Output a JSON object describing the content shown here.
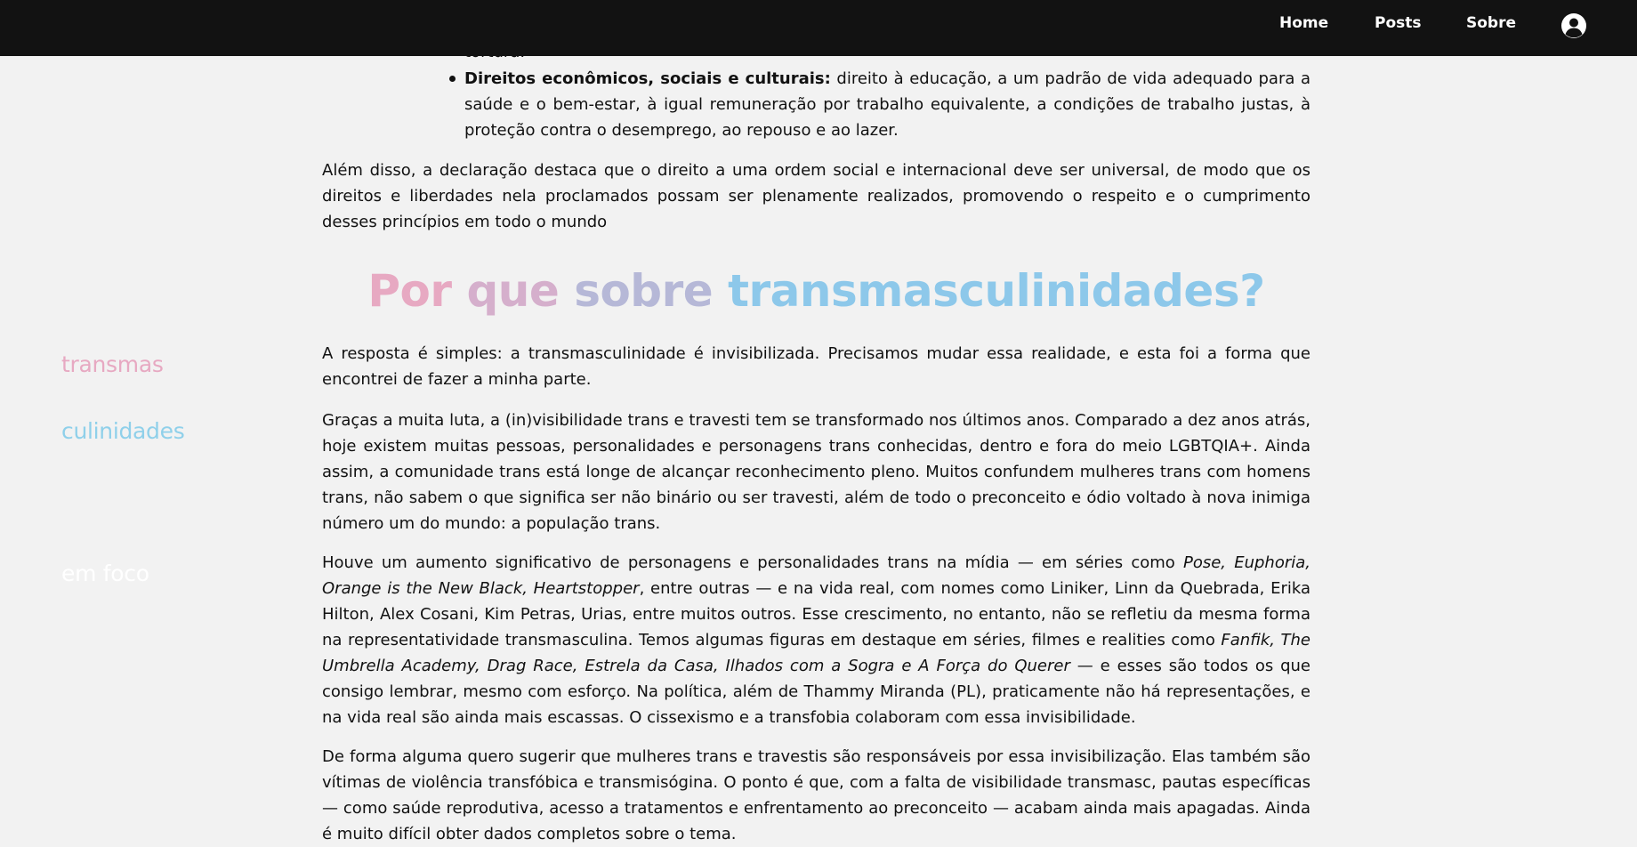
{
  "navbar": {
    "brand_part1": "transmas",
    "brand_part2": "culinidades",
    "brand_part3": " em foco",
    "links": [
      "Home",
      "Posts",
      "Sobre"
    ],
    "user_icon": "user-circle-icon",
    "colors": {
      "pink": "#e7a9c2",
      "blue": "#8fd0ea",
      "bar": "#121212"
    }
  },
  "article": {
    "clipped_top": "tortura.",
    "rights_list": [
      {
        "title": "Direitos econômicos, sociais e culturais:",
        "text": " direito à educação, a um padrão de vida adequado para a saúde e o bem-estar, à igual remuneração por trabalho equivalente, a condições de trabalho justas, à proteção contra o desemprego, ao repouso e ao lazer."
      }
    ],
    "paragraph_alem": "Além disso, a declaração destaca que o direito a uma ordem social e internacional deve ser universal, de modo que os direitos e liberdades nela proclamados possam ser plenamente realizados, promovendo o respeito e o cumprimento desses princípios em todo o mundo",
    "heading": {
      "w1": "Por ",
      "w2": "que ",
      "w3": "sobre ",
      "w4": "transmasculinidades?"
    },
    "p1": "A resposta é simples: a transmasculinidade é invisibilizada. Precisamos mudar essa realidade, e esta foi a forma que encontrei de fazer a minha parte.",
    "p2": "Graças a muita luta, a (in)visibilidade trans e travesti tem se transformado nos últimos anos. Comparado a dez anos atrás, hoje existem muitas pessoas, personalidades e personagens trans conhecidas, dentro e fora do meio LGBTQIA+. Ainda assim, a comunidade trans está longe de alcançar reconhecimento pleno. Muitos confundem mulheres trans com homens trans, não sabem o que significa ser não binário ou ser travesti, além de todo o preconceito e ódio voltado à nova inimiga número um do mundo: a população trans.",
    "p3": {
      "a": "Houve um aumento significativo de personagens e personalidades trans na mídia — em séries como ",
      "b": "Pose, Euphoria, Orange is the New Black, Heartstopper",
      "c": ", entre outras — e na vida real, com nomes como Liniker, Linn da Quebrada, Erika Hilton, Alex Cosani, Kim Petras, Urias, entre muitos outros. Esse crescimento, no entanto, não se refletiu da mesma forma na representatividade transmasculina. Temos algumas figuras em destaque em séries, filmes e realities como ",
      "d": "Fanfik, The Umbrella Academy, Drag Race, Estrela da Casa, Ilhados com a Sogra e A Força do Querer",
      "e": " — e esses são todos os que consigo lembrar, mesmo com esforço. Na política, além de Thammy Miranda (PL), praticamente não há representações, e na vida real são ainda mais escassas. O cissexismo e a transfobia colaboram com essa invisibilidade."
    },
    "p4": "De forma alguma quero sugerir que mulheres trans e travestis são responsáveis por essa invisibilização. Elas também são vítimas de violência transfóbica e transmisógina. O ponto é que, com a falta de visibilidade transmasc, pautas específicas — como saúde reprodutiva, acesso a tratamentos e enfrentamento ao preconceito — acabam ainda mais apagadas. Ainda é muito difícil obter dados completos sobre o tema."
  }
}
